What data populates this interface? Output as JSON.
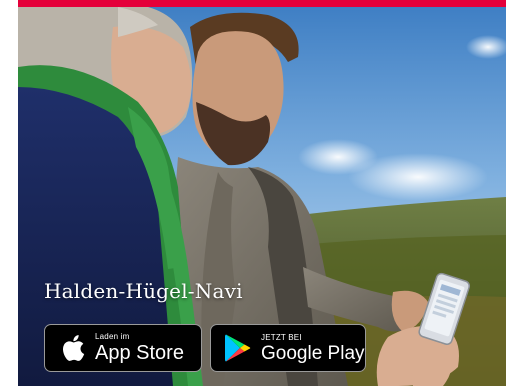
{
  "header": {
    "accent_color": "#e4003a"
  },
  "hero": {
    "image_icon": "photo-two-men-with-smartphone",
    "title": "Halden-Hügel-Navi"
  },
  "badges": {
    "app_store": {
      "icon": "apple-icon",
      "small_label": "Laden im",
      "large_label": "App Store"
    },
    "google_play": {
      "icon": "google-play-icon",
      "small_label": "JETZT BEI",
      "large_label": "Google Play"
    }
  }
}
